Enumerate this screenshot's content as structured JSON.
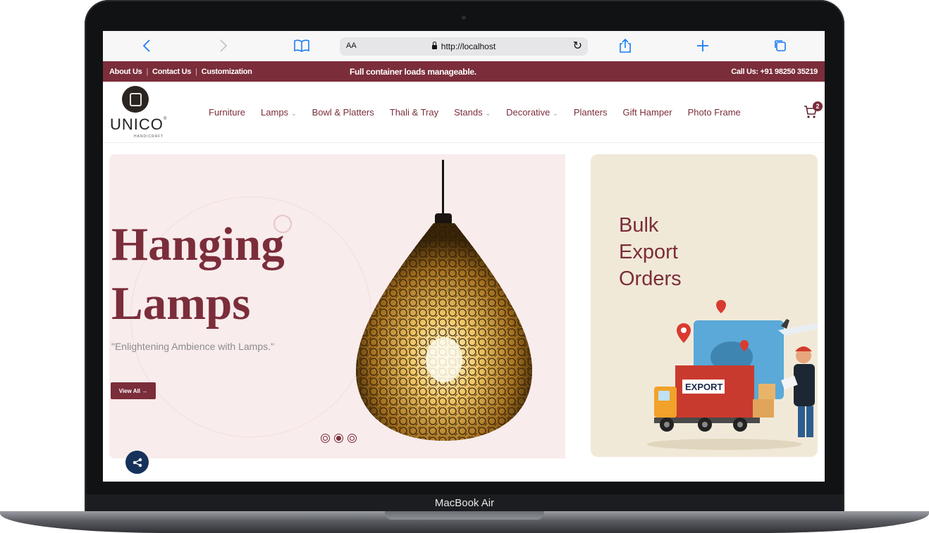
{
  "device": {
    "model": "MacBook Air"
  },
  "browser": {
    "text_size_label": "AA",
    "url": "http://localhost",
    "icons": [
      "back-icon",
      "forward-icon",
      "bookmarks-icon",
      "reload-icon",
      "share-icon",
      "new-tab-icon",
      "tabs-icon"
    ]
  },
  "topbar": {
    "links": [
      "About Us",
      "Contact Us",
      "Customization"
    ],
    "promo": "Full container loads manageable.",
    "phone": "Call Us: +91 98250 35219"
  },
  "header": {
    "logo_text": "UNICO",
    "logo_subtext": "HANDICRAFT",
    "nav": [
      {
        "label": "Furniture",
        "dropdown": false
      },
      {
        "label": "Lamps",
        "dropdown": true
      },
      {
        "label": "Bowl & Platters",
        "dropdown": false
      },
      {
        "label": "Thali & Tray",
        "dropdown": false
      },
      {
        "label": "Stands",
        "dropdown": true
      },
      {
        "label": "Decorative",
        "dropdown": true
      },
      {
        "label": "Planters",
        "dropdown": false
      },
      {
        "label": "Gift Hamper",
        "dropdown": false
      },
      {
        "label": "Photo Frame",
        "dropdown": false
      }
    ],
    "cart_count": "2"
  },
  "hero": {
    "title_line1": "Hanging",
    "title_line2": "Lamps",
    "subtitle": "\"Enlightening Ambience with Lamps.\"",
    "button_label": "View All →",
    "slides": 3,
    "active_slide": 2
  },
  "promo": {
    "line1": "Bulk",
    "line2": "Export",
    "line3": "Orders",
    "art_label": "EXPORT"
  },
  "colors": {
    "brand": "#7b2d3a",
    "hero_bg": "#f8ecec",
    "promo_bg": "#f1e9d8",
    "share_bg": "#16325a"
  }
}
